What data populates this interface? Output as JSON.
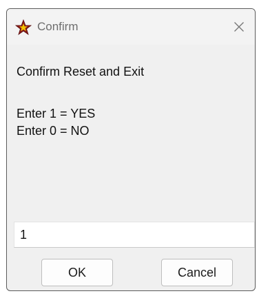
{
  "window": {
    "title": "Confirm",
    "close_glyph": "✕",
    "icon": "star-icon"
  },
  "dialog": {
    "prompt": "Confirm Reset and Exit",
    "options": [
      "Enter 1 = YES",
      "Enter 0 = NO"
    ],
    "input_value": "1"
  },
  "buttons": {
    "ok_label": "OK",
    "cancel_label": "Cancel"
  },
  "colors": {
    "icon_fill": "#8b1a1a",
    "icon_accent": "#f2c500"
  }
}
